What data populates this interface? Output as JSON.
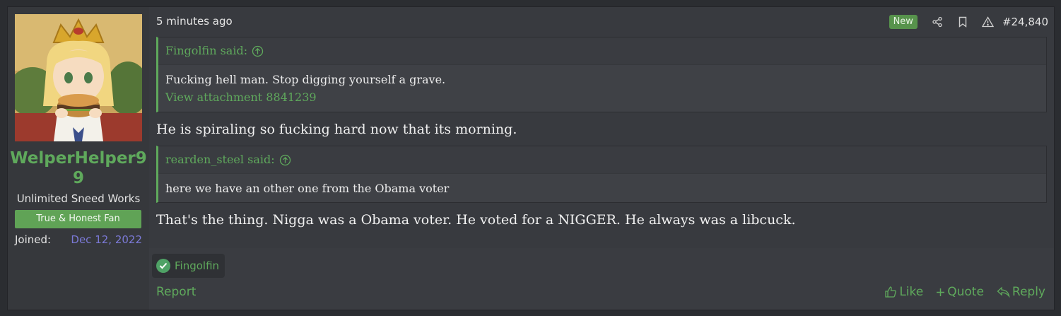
{
  "user": {
    "name": "WelperHelper99",
    "title": "Unlimited Sneed Works",
    "banner": "True & Honest Fan",
    "joined_label": "Joined:",
    "joined_value": "Dec 12, 2022"
  },
  "post": {
    "time": "5 minutes ago",
    "badge": "New",
    "number": "#24,840",
    "quotes": [
      {
        "author_line": "Fingolfin said:",
        "text": "Fucking hell man. Stop digging yourself a grave.",
        "attachment": "View attachment 8841239"
      },
      {
        "author_line": "rearden_steel said:",
        "text": "here we have an other one from the Obama voter"
      }
    ],
    "paragraphs": [
      "He is spiraling so fucking hard now that its morning.",
      "That's the thing. Nigga was a Obama voter. He voted for a NIGGER. He always was a libcuck."
    ]
  },
  "reactions": {
    "names": "Fingolfin"
  },
  "footer": {
    "report": "Report",
    "like": "Like",
    "quote": "Quote",
    "reply": "Reply"
  },
  "icons": [
    "share-icon",
    "bookmark-icon",
    "warning-icon",
    "arrow-up-circle-icon",
    "check-circle-icon",
    "thumbs-up-icon",
    "plus-icon",
    "reply-icon"
  ],
  "colors": {
    "accent": "#5fa95c",
    "background": "#383a3f",
    "joined_date": "#7b79d6"
  }
}
